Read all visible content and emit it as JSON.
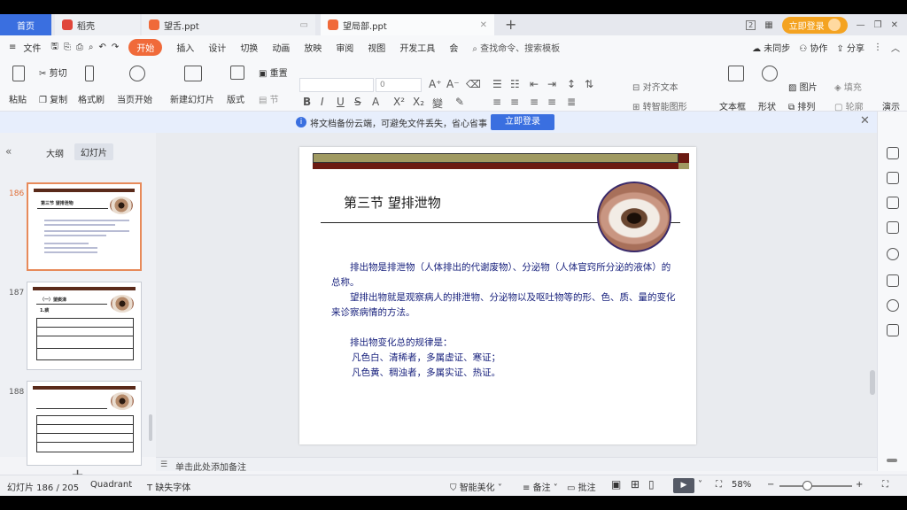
{
  "tabs": {
    "home": "首页",
    "wps": "稻壳",
    "doc1": "望舌.ppt",
    "doc2": "望局部.ppt",
    "new": "+"
  },
  "window": {
    "login": "立即登录",
    "controls": [
      "2",
      "—",
      "❐",
      "✕"
    ]
  },
  "menu": {
    "file": "文件",
    "items": [
      "开始",
      "插入",
      "设计",
      "切换",
      "动画",
      "放映",
      "审阅",
      "视图",
      "开发工具",
      "会"
    ],
    "search": "查找命令、搜索模板",
    "sync": "未同步",
    "collab": "协作",
    "share": "分享"
  },
  "ribbon": {
    "paste": "粘贴",
    "cut": "剪切",
    "copy": "复制",
    "format_painter": "格式刷",
    "start_from_current": "当页开始",
    "new_slide": "新建幻灯片",
    "layout": "版式",
    "section": "节",
    "reset": "重置",
    "font_size": "0",
    "align_text": "对齐文本",
    "smart_art": "转智能图形",
    "textbox": "文本框",
    "shape": "形状",
    "picture": "图片",
    "fill": "填充",
    "arrange": "排列",
    "outline": "轮廓",
    "present": "演示"
  },
  "notification": {
    "text": "将文档备份云端，可避免文件丢失，省心省事",
    "button": "立即登录",
    "close": "✕"
  },
  "left_panel": {
    "outline_tab": "大纲",
    "slides_tab": "幻灯片",
    "thumb_numbers": [
      "186",
      "187",
      "188"
    ],
    "thumb1_title": "第三节 望排泄物",
    "thumb2_title": "（一）望痰涕",
    "thumb2_sub": "1.痰",
    "add": "+"
  },
  "slide": {
    "title": "第三节  望排泄物",
    "para1": "排出物是排泄物（人体排出的代谢废物）、分泌物（人体官窍所分泌的液体）的总称。",
    "para2": "望排出物就是观察病人的排泄物、分泌物以及呕吐物等的形、色、质、量的变化来诊察病情的方法。",
    "para3": "排出物变化总的规律是：",
    "line1": "凡色白、清稀者，多属虚证、寒证；",
    "line2": "凡色黄、稠浊者，多属实证、热证。"
  },
  "notes": {
    "placeholder": "单击此处添加备注"
  },
  "status": {
    "slide_counter": "幻灯片 186 / 205",
    "theme": "Quadrant",
    "missing_font": "缺失字体",
    "beautify": "智能美化",
    "notes": "备注",
    "comments": "批注",
    "zoom": "58%"
  }
}
